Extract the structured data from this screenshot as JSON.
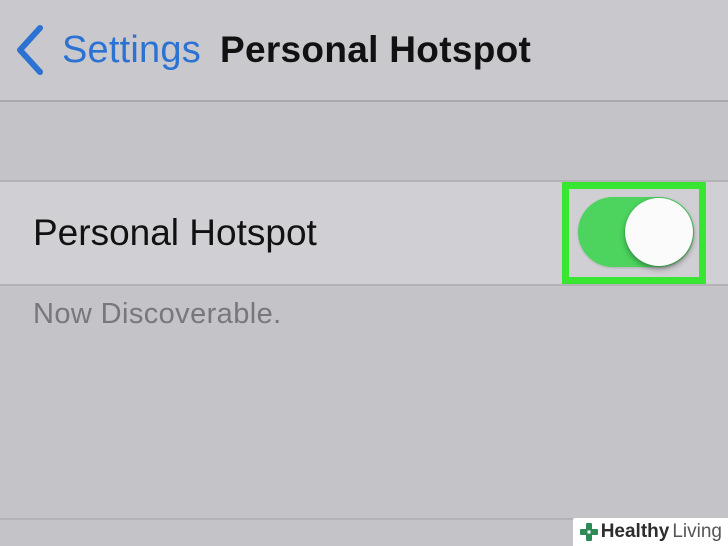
{
  "navbar": {
    "back_label": "Settings",
    "title": "Personal Hotspot"
  },
  "hotspot_row": {
    "label": "Personal Hotspot",
    "toggle_state": "on"
  },
  "status": {
    "text": "Now Discoverable."
  },
  "watermark": {
    "brand_bold": "Healthy",
    "brand_light": "Living"
  },
  "colors": {
    "accent_blue": "#2b72d3",
    "toggle_green": "#4cd45f",
    "highlight_green": "#38e632",
    "background": "#c4c3c8"
  },
  "icons": {
    "back": "chevron-left-icon",
    "watermark": "plus-cross-icon"
  }
}
